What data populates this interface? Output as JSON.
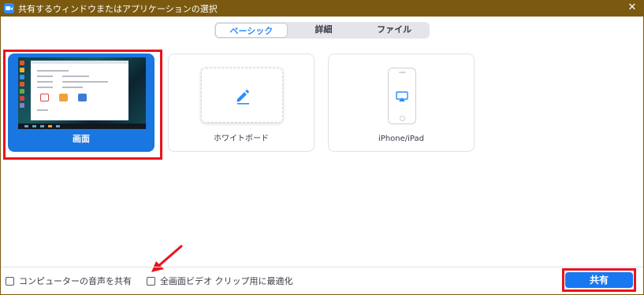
{
  "window": {
    "title": "共有するウィンドウまたはアプリケーションの選択",
    "close_symbol": "✕"
  },
  "tabs": [
    {
      "label": "ベーシック",
      "active": true
    },
    {
      "label": "詳細",
      "active": false
    },
    {
      "label": "ファイル",
      "active": false
    }
  ],
  "tiles": {
    "screen": {
      "label": "画面",
      "selected": true
    },
    "whiteboard": {
      "label": "ホワイトボード",
      "icon": "pencil-icon"
    },
    "ipad": {
      "label": "iPhone/iPad",
      "icon": "airplay-icon"
    }
  },
  "options": {
    "share_computer_audio": {
      "label": "コンピューターの音声を共有",
      "checked": false
    },
    "optimize_video": {
      "label": "全画面ビデオ クリップ用に最適化",
      "checked": false
    }
  },
  "actions": {
    "share_label": "共有"
  },
  "colors": {
    "title_bar": "#7b5a10",
    "accent": "#1778f2",
    "highlight_box": "#e8141d"
  }
}
